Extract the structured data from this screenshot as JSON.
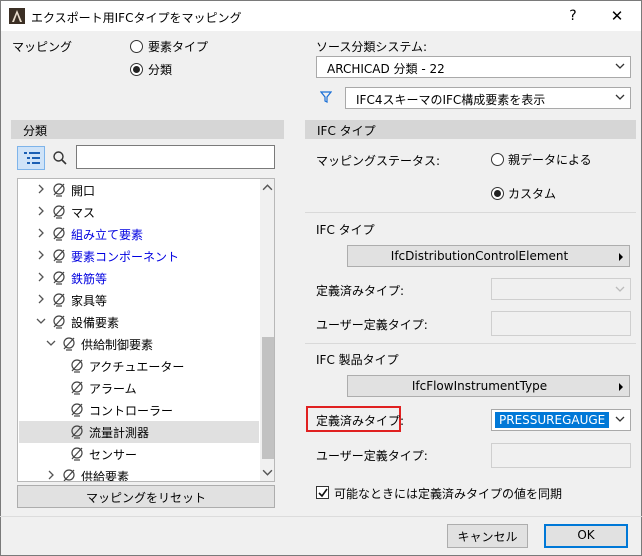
{
  "window": {
    "title": "エクスポート用IFCタイプをマッピング",
    "help": "?",
    "close": "✕"
  },
  "mapping": {
    "label": "マッピング",
    "options": [
      "要素タイプ",
      "分類"
    ],
    "selected": "分類"
  },
  "source_system": {
    "label": "ソース分類システム:",
    "value": "ARCHICAD 分類 - 22",
    "filter_value": "IFC4スキーマのIFC構成要素を表示"
  },
  "left_panel": {
    "header": "分類",
    "search_placeholder": "",
    "tree": [
      {
        "label": "開口",
        "level": 0,
        "expander": ">",
        "color": "black",
        "selected": false
      },
      {
        "label": "マス",
        "level": 0,
        "expander": ">",
        "color": "black",
        "selected": false
      },
      {
        "label": "組み立て要素",
        "level": 0,
        "expander": ">",
        "color": "blue",
        "selected": false
      },
      {
        "label": "要素コンポーネント",
        "level": 0,
        "expander": ">",
        "color": "blue",
        "selected": false
      },
      {
        "label": "鉄筋等",
        "level": 0,
        "expander": ">",
        "color": "blue",
        "selected": false
      },
      {
        "label": "家具等",
        "level": 0,
        "expander": ">",
        "color": "black",
        "selected": false
      },
      {
        "label": "設備要素",
        "level": 0,
        "expander": "v",
        "color": "black",
        "selected": false
      },
      {
        "label": "供給制御要素",
        "level": 1,
        "expander": "v",
        "color": "black",
        "selected": false
      },
      {
        "label": "アクチュエーター",
        "level": 2,
        "expander": "",
        "color": "black",
        "selected": false
      },
      {
        "label": "アラーム",
        "level": 2,
        "expander": "",
        "color": "black",
        "selected": false
      },
      {
        "label": "コントローラー",
        "level": 2,
        "expander": "",
        "color": "black",
        "selected": false
      },
      {
        "label": "流量計測器",
        "level": 2,
        "expander": "",
        "color": "black",
        "selected": true
      },
      {
        "label": "センサー",
        "level": 2,
        "expander": "",
        "color": "black",
        "selected": false
      },
      {
        "label": "供給要素",
        "level": 1,
        "expander": ">",
        "color": "black",
        "selected": false
      }
    ],
    "reset_button": "マッピングをリセット"
  },
  "right_panel": {
    "header": "IFC タイプ",
    "status_label": "マッピングステータス:",
    "status_options": [
      "親データによる",
      "カスタム"
    ],
    "status_selected": "カスタム",
    "ifc_type_section": "IFC タイプ",
    "ifc_type_value": "IfcDistributionControlElement",
    "predefined_label": "定義済みタイプ:",
    "user_defined_label": "ユーザー定義タイプ:",
    "product_section": "IFC 製品タイプ",
    "product_value": "IfcFlowInstrumentType",
    "product_predefined_label": "定義済みタイプ:",
    "product_predefined_value": "PRESSUREGAUGE",
    "product_user_defined_label": "ユーザー定義タイプ:",
    "sync_checkbox_label": "可能なときには定義済みタイプの値を同期",
    "sync_checked": true
  },
  "footer": {
    "cancel": "キャンセル",
    "ok": "OK"
  },
  "colors": {
    "accent": "#0078d7",
    "highlight_border": "#e02020",
    "tree_link": "#0000e0"
  }
}
